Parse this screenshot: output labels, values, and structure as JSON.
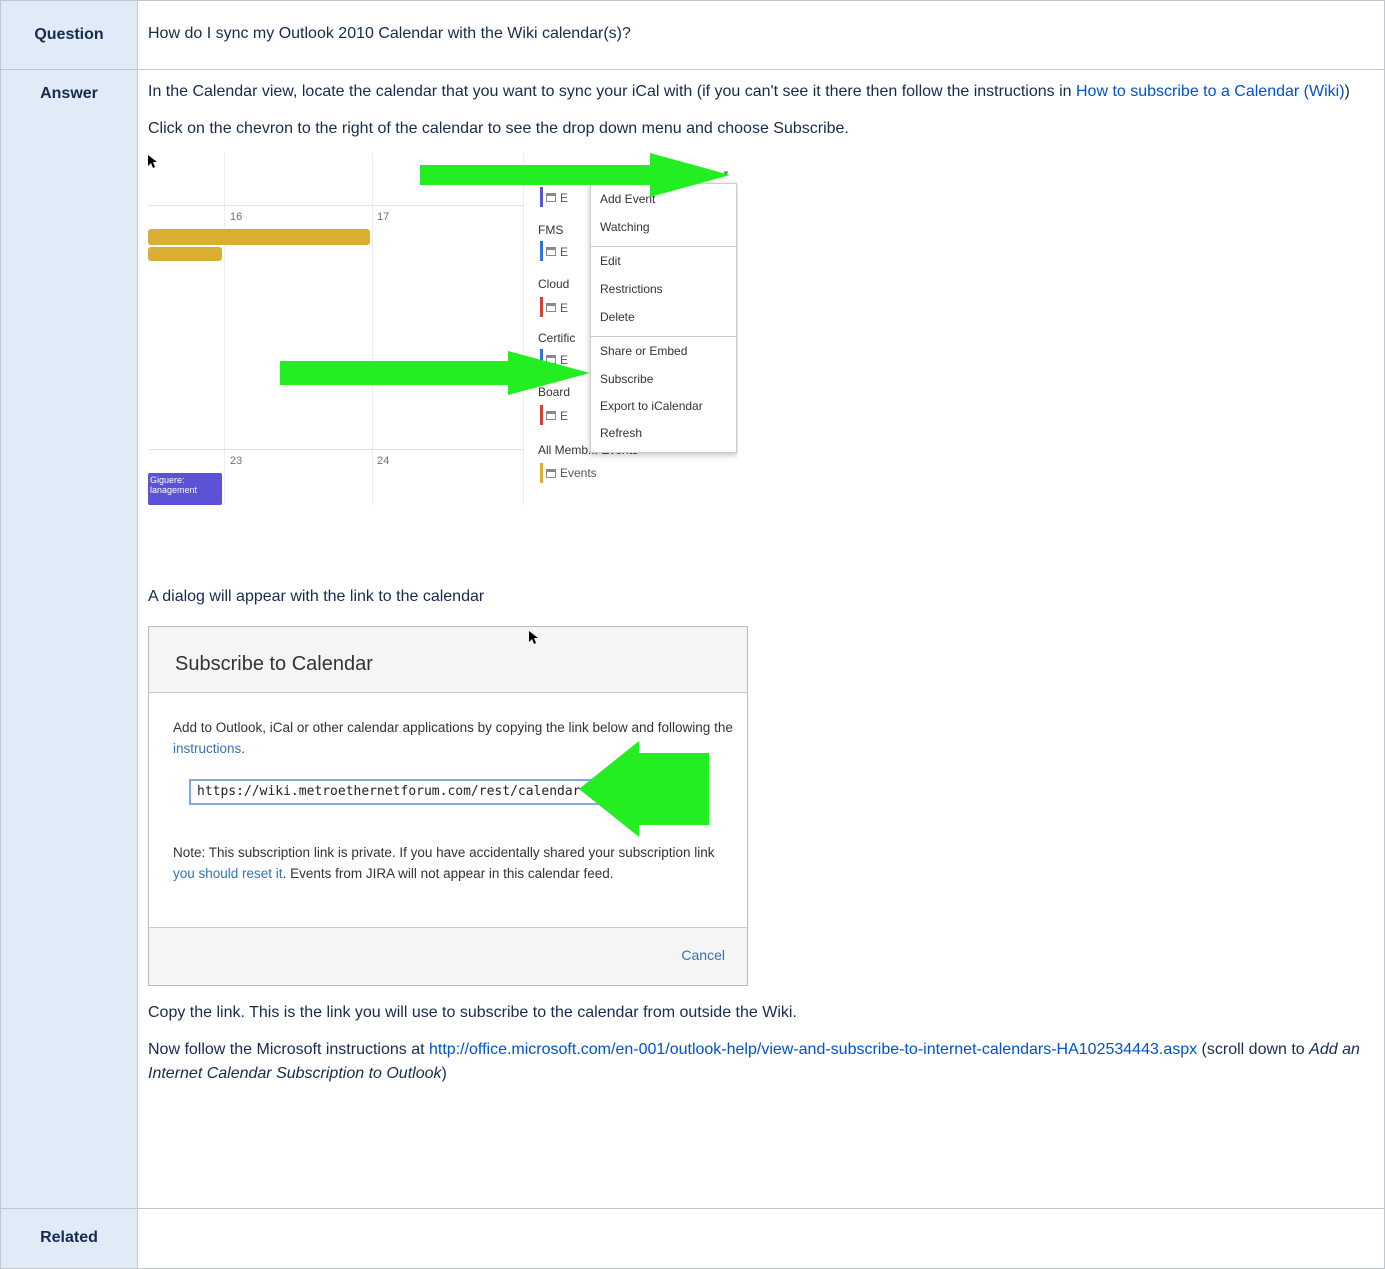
{
  "question_label": "Question",
  "question_text": "How do I sync my Outlook 2010 Calendar with the Wiki calendar(s)?",
  "answer_label": "Answer",
  "related_label": "Related",
  "answer": {
    "p1_text": "In the Calendar view, locate the calendar that you want to sync your iCal with (if you can't see it there then follow the instructions in ",
    "p1_link": "How to subscribe to a Calendar (Wiki)",
    "p1_end": ")",
    "p2_text": "Click on the chevron to the right of the calendar to see the drop down menu and choose Subscribe.",
    "p3_text": "A dialog will appear with the link to the calendar",
    "p4_text": "Copy the link. This is the link you will use to subscribe to the calendar from outside the Wiki.",
    "p5_pre": "Now follow the Microsoft instructions at ",
    "p5_link": "http://office.microsoft.com/en-001/outlook-help/view-and-subscribe-to-internet-calendars-HA102534443.aspx",
    "p5_mid": " (scroll down to ",
    "p5_em": "Add an Internet Calendar Subscription to Outlook",
    "p5_end": ")"
  },
  "calendar_screenshot": {
    "day_numbers": [
      "16",
      "17",
      "23",
      "24"
    ],
    "event_text": "Giguere: lanagement",
    "calendar_labels": [
      "E",
      "FMS",
      "E",
      "Cloud",
      "E",
      "Certific",
      "E",
      "Board",
      "E",
      "All Memb... Events"
    ],
    "events_label": "Events",
    "menu_items": [
      "Add Event",
      "Watching",
      "Edit",
      "Restrictions",
      "Delete",
      "Share or Embed",
      "Subscribe",
      "Export to iCalendar",
      "Refresh"
    ]
  },
  "dialog_screenshot": {
    "title": "Subscribe to Calendar",
    "body_pre": "Add to Outlook, iCal or other calendar applications by copying the link below and following the ",
    "body_link": "instructions",
    "body_end": ".",
    "url": "https://wiki.metroethernetforum.com/rest/calendar",
    "note_pre": "Note: This subscription link is private. If you have accidentally shared your subscription link ",
    "note_link": "you should reset it",
    "note_end": ". Events from JIRA will not appear in this calendar feed.",
    "cancel": "Cancel"
  },
  "colors": {
    "header_bg": "#e0ebf7",
    "link": "#0052cc",
    "arrow": "#22ee22",
    "calendar_yellow": "#d8ae33",
    "calendar_purple": "#5b52d6"
  }
}
